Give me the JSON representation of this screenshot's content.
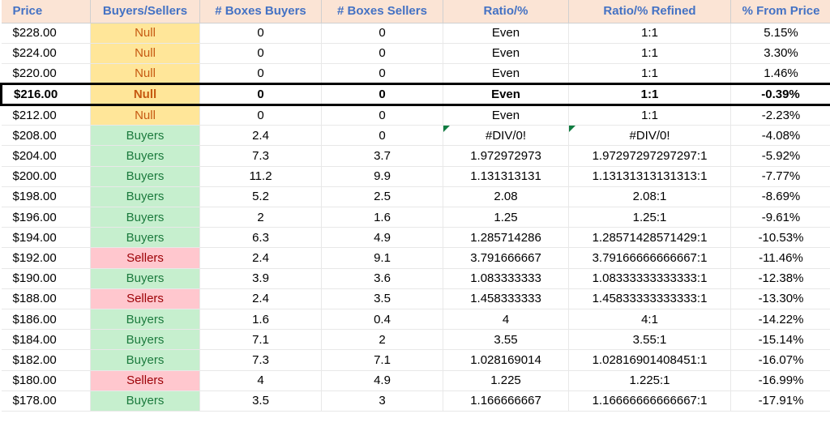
{
  "chart_data": {
    "type": "table",
    "title": "",
    "columns": [
      "Price",
      "Buyers/Sellers",
      "# Boxes Buyers",
      "# Boxes Sellers",
      "Ratio/%",
      "Ratio/% Refined",
      "% From Price"
    ],
    "rows": [
      [
        "$228.00",
        "Null",
        "0",
        "0",
        "Even",
        "1:1",
        "5.15%"
      ],
      [
        "$224.00",
        "Null",
        "0",
        "0",
        "Even",
        "1:1",
        "3.30%"
      ],
      [
        "$220.00",
        "Null",
        "0",
        "0",
        "Even",
        "1:1",
        "1.46%"
      ],
      [
        "$216.00",
        "Null",
        "0",
        "0",
        "Even",
        "1:1",
        "-0.39%"
      ],
      [
        "$212.00",
        "Null",
        "0",
        "0",
        "Even",
        "1:1",
        "-2.23%"
      ],
      [
        "$208.00",
        "Buyers",
        "2.4",
        "0",
        "#DIV/0!",
        "#DIV/0!",
        "-4.08%"
      ],
      [
        "$204.00",
        "Buyers",
        "7.3",
        "3.7",
        "1.972972973",
        "1.97297297297297:1",
        "-5.92%"
      ],
      [
        "$200.00",
        "Buyers",
        "11.2",
        "9.9",
        "1.131313131",
        "1.13131313131313:1",
        "-7.77%"
      ],
      [
        "$198.00",
        "Buyers",
        "5.2",
        "2.5",
        "2.08",
        "2.08:1",
        "-8.69%"
      ],
      [
        "$196.00",
        "Buyers",
        "2",
        "1.6",
        "1.25",
        "1.25:1",
        "-9.61%"
      ],
      [
        "$194.00",
        "Buyers",
        "6.3",
        "4.9",
        "1.285714286",
        "1.28571428571429:1",
        "-10.53%"
      ],
      [
        "$192.00",
        "Sellers",
        "2.4",
        "9.1",
        "3.791666667",
        "3.79166666666667:1",
        "-11.46%"
      ],
      [
        "$190.00",
        "Buyers",
        "3.9",
        "3.6",
        "1.083333333",
        "1.08333333333333:1",
        "-12.38%"
      ],
      [
        "$188.00",
        "Sellers",
        "2.4",
        "3.5",
        "1.458333333",
        "1.45833333333333:1",
        "-13.30%"
      ],
      [
        "$186.00",
        "Buyers",
        "1.6",
        "0.4",
        "4",
        "4:1",
        "-14.22%"
      ],
      [
        "$184.00",
        "Buyers",
        "7.1",
        "2",
        "3.55",
        "3.55:1",
        "-15.14%"
      ],
      [
        "$182.00",
        "Buyers",
        "7.3",
        "7.1",
        "1.028169014",
        "1.02816901408451:1",
        "-16.07%"
      ],
      [
        "$180.00",
        "Sellers",
        "4",
        "4.9",
        "1.225",
        "1.225:1",
        "-16.99%"
      ],
      [
        "$178.00",
        "Buyers",
        "3.5",
        "3",
        "1.166666667",
        "1.16666666666667:1",
        "-17.91%"
      ]
    ],
    "highlighted_row_index": 3,
    "error_indicator_row_index": 5
  },
  "headers": {
    "price": "Price",
    "bs": "Buyers/Sellers",
    "bb": "# Boxes Buyers",
    "sb": "# Boxes Sellers",
    "ratio": "Ratio/%",
    "rref": "Ratio/% Refined",
    "pfp": "% From Price"
  }
}
